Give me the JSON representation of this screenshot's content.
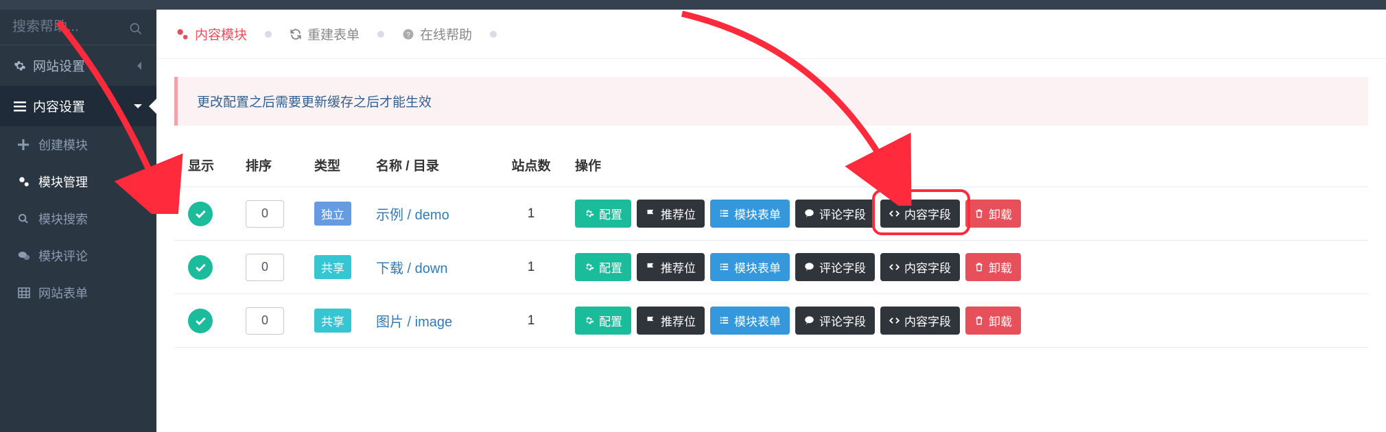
{
  "sidebar": {
    "search_placeholder": "搜索帮助...",
    "nav1": {
      "label": "网站设置"
    },
    "nav2": {
      "label": "内容设置"
    },
    "subs": [
      {
        "label": "创建模块"
      },
      {
        "label": "模块管理"
      },
      {
        "label": "模块搜索"
      },
      {
        "label": "模块评论"
      },
      {
        "label": "网站表单"
      }
    ]
  },
  "toolbar": {
    "content_module": "内容模块",
    "rebuild_form": "重建表单",
    "online_help": "在线帮助"
  },
  "alert": "更改配置之后需要更新缓存之后才能生效",
  "table": {
    "headers": {
      "show": "显示",
      "sort": "排序",
      "type": "类型",
      "name": "名称 / 目录",
      "sites": "站点数",
      "ops": "操作"
    },
    "rows": [
      {
        "sort": "0",
        "type": "独立",
        "type_color": "blue",
        "name": "示例 / demo",
        "sites": "1"
      },
      {
        "sort": "0",
        "type": "共享",
        "type_color": "green",
        "name": "下载 / down",
        "sites": "1"
      },
      {
        "sort": "0",
        "type": "共享",
        "type_color": "green",
        "name": "图片 / image",
        "sites": "1"
      }
    ],
    "btn_labels": {
      "config": "配置",
      "recommend": "推荐位",
      "form": "模块表单",
      "comment": "评论字段",
      "content": "内容字段",
      "uninstall": "卸载"
    }
  }
}
